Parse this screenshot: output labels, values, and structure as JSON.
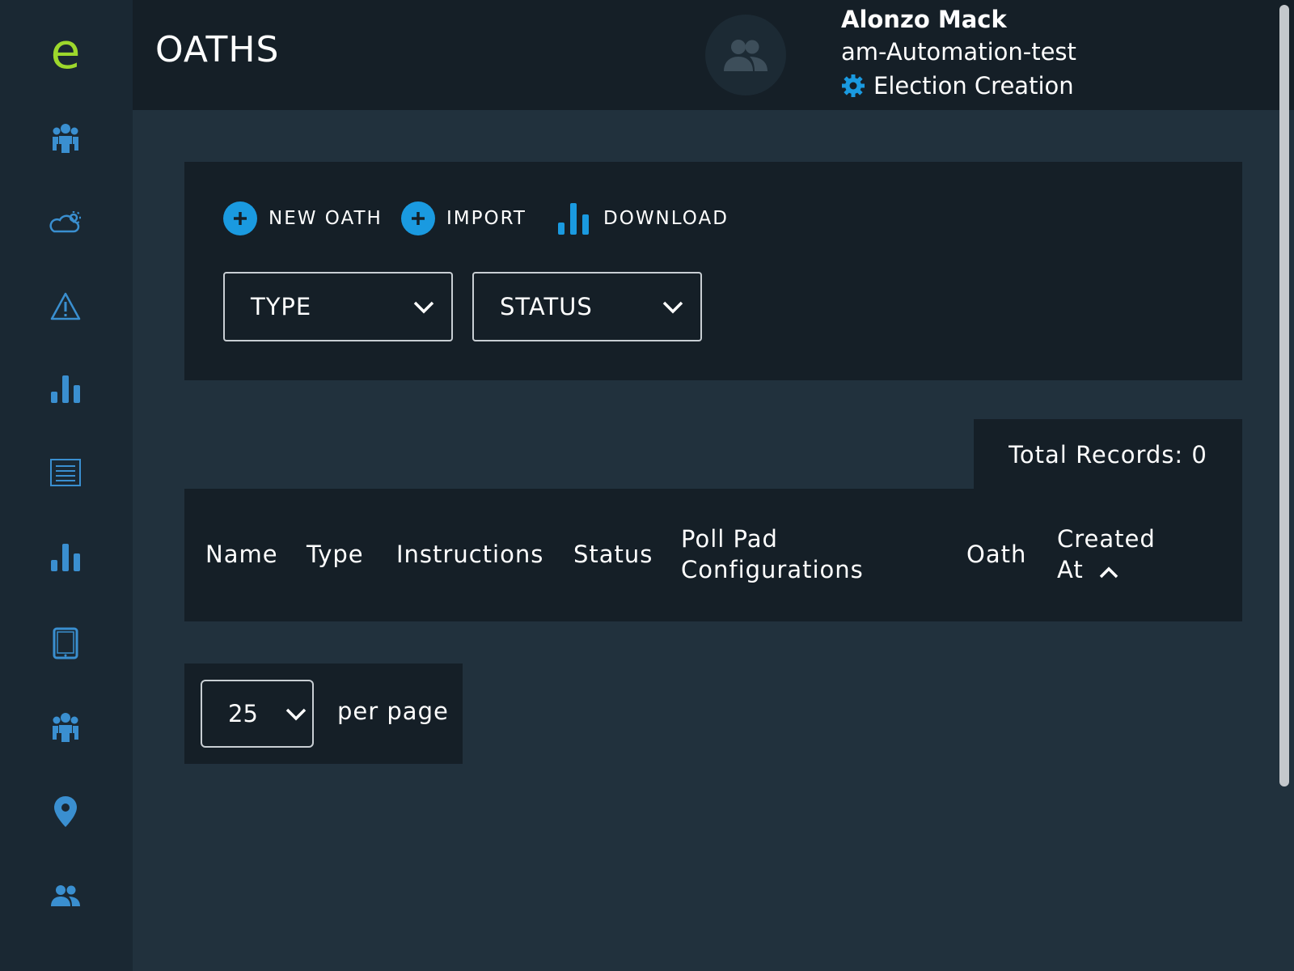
{
  "header": {
    "title": "OATHS",
    "user_name": "Alonzo Mack",
    "organization": "am-Automation-test",
    "mode": "Election Creation"
  },
  "sidebar": {
    "logo": "e",
    "items": [
      {
        "icon": "group-icon"
      },
      {
        "icon": "weather-icon"
      },
      {
        "icon": "warning-icon"
      },
      {
        "icon": "bar-chart-icon"
      },
      {
        "icon": "receipt-icon"
      },
      {
        "icon": "bar-chart-icon"
      },
      {
        "icon": "tablet-icon"
      },
      {
        "icon": "group-icon"
      },
      {
        "icon": "location-pin-icon"
      },
      {
        "icon": "users-icon"
      }
    ]
  },
  "toolbar": {
    "new_oath_label": "NEW OATH",
    "import_label": "IMPORT",
    "download_label": "DOWNLOAD"
  },
  "filters": {
    "type_label": "TYPE",
    "status_label": "STATUS"
  },
  "table": {
    "total_records": "Total Records: 0",
    "columns": [
      "Name",
      "Type",
      "Instructions",
      "Status",
      "Poll Pad Configurations",
      "Oath",
      "Created At"
    ],
    "rows": []
  },
  "pagination": {
    "per_page_value": "25",
    "per_page_label": "per page"
  },
  "colors": {
    "accent": "#1a9ae0",
    "logo": "#9dd82c",
    "sidebar_icon": "#3a8fd0",
    "background": "#21313d",
    "panel": "#151f27"
  }
}
